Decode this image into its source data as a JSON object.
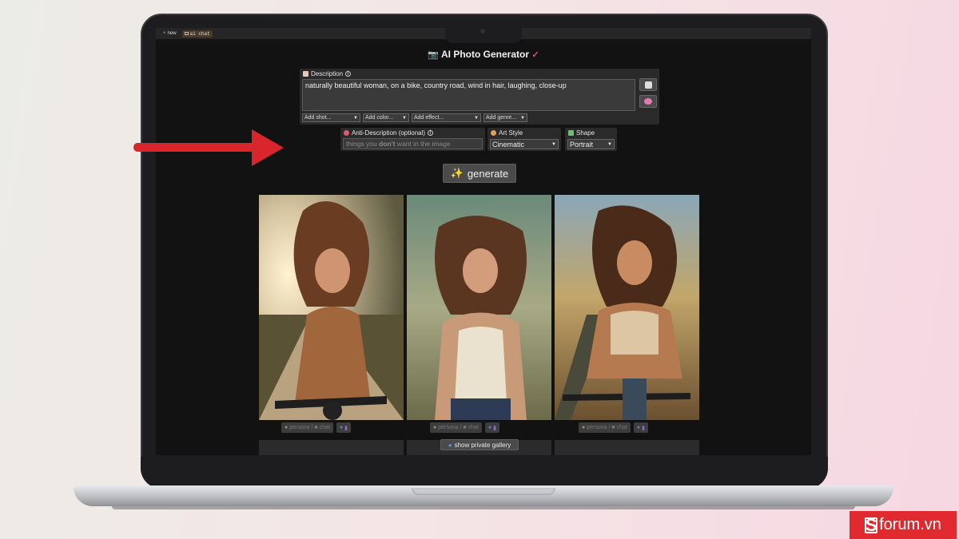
{
  "topbar": {
    "tabs": [
      {
        "label": "new",
        "icon": "plus-icon"
      },
      {
        "label": "ai chat",
        "icon": "chat-window-icon"
      }
    ]
  },
  "app": {
    "title": "AI Photo Generator",
    "title_left_icon": "camera-icon",
    "title_right_icon": "paint-brush-icon"
  },
  "description": {
    "label": "Description",
    "value": "naturally beautiful woman, on a bike, country road, wind in hair, laughing, close-up",
    "dropdowns": [
      "Add shot...",
      "Add color...",
      "Add effect...",
      "Add genre..."
    ],
    "side_buttons": [
      {
        "icon": "dice-icon"
      },
      {
        "icon": "brain-icon"
      }
    ]
  },
  "anti_description": {
    "label": "Anti-Description (optional)",
    "placeholder_before": "things you ",
    "placeholder_bold": "don't",
    "placeholder_after": " want in the image"
  },
  "art_style": {
    "label": "Art Style",
    "value": "Cinematic"
  },
  "shape": {
    "label": "Shape",
    "value": "Portrait"
  },
  "generate": {
    "label": "generate",
    "icon": "sparkles-icon"
  },
  "actions": {
    "persona_label": "persona /",
    "chat_label": "chat"
  },
  "gallery": {
    "label": "show private gallery",
    "icon": "shield-icon"
  },
  "colors": {
    "accent": "#e02a2f",
    "screen_bg": "#121212",
    "panel": "#2a2a2a"
  },
  "watermark": {
    "text": "forum.vn",
    "logo_letter": "S"
  }
}
